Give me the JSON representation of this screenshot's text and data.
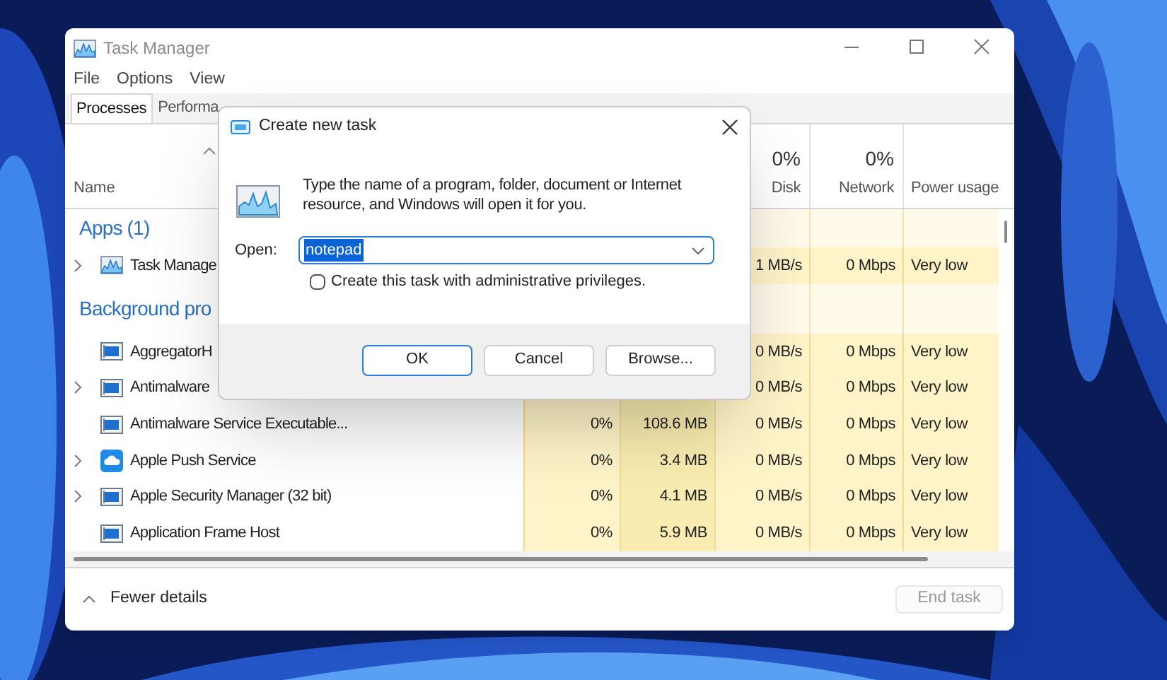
{
  "task_manager": {
    "title": "Task Manager",
    "menu": [
      "File",
      "Options",
      "View"
    ],
    "tabs": [
      {
        "label": "Processes",
        "selected": true
      },
      {
        "label": "Performa",
        "selected": false
      }
    ],
    "header": {
      "name": "Name",
      "disk": {
        "percent": "0%",
        "label": "Disk"
      },
      "network": {
        "percent": "0%",
        "label": "Network"
      },
      "power": {
        "label": "Power usage"
      }
    },
    "groups": [
      {
        "title": "Apps (1)",
        "rows": [
          {
            "name": "Task Manage",
            "expandable": true,
            "kind": "graph",
            "disk": "1 MB/s",
            "network": "0 Mbps",
            "power": "Very low"
          }
        ]
      },
      {
        "title": "Background pro",
        "rows": [
          {
            "name": "AggregatorH",
            "expandable": false,
            "kind": "window",
            "disk": "0 MB/s",
            "network": "0 Mbps",
            "power": "Very low"
          },
          {
            "name": "Antimalware",
            "expandable": true,
            "kind": "window",
            "disk": "0 MB/s",
            "network": "0 Mbps",
            "power": "Very low"
          },
          {
            "name": "Antimalware Service Executable...",
            "expandable": false,
            "kind": "window",
            "cpu": "0%",
            "memory": "108.6 MB",
            "disk": "0 MB/s",
            "network": "0 Mbps",
            "power": "Very low"
          },
          {
            "name": "Apple Push Service",
            "expandable": true,
            "kind": "cloud",
            "cpu": "0%",
            "memory": "3.4 MB",
            "disk": "0 MB/s",
            "network": "0 Mbps",
            "power": "Very low"
          },
          {
            "name": "Apple Security Manager (32 bit)",
            "expandable": true,
            "kind": "window",
            "cpu": "0%",
            "memory": "4.1 MB",
            "disk": "0 MB/s",
            "network": "0 Mbps",
            "power": "Very low"
          },
          {
            "name": "Application Frame Host",
            "expandable": false,
            "kind": "window",
            "cpu": "0%",
            "memory": "5.9 MB",
            "disk": "0 MB/s",
            "network": "0 Mbps",
            "power": "Very low"
          }
        ]
      }
    ],
    "footer": {
      "details": "Fewer details",
      "end_task": {
        "label": "End task",
        "disabled": true
      }
    }
  },
  "dialog": {
    "title": "Create new task",
    "message": "Type the name of a program, folder, document or Internet resource, and Windows will open it for you.",
    "open_label": "Open:",
    "open_value": "notepad",
    "value_selected": true,
    "checkbox": {
      "label": "Create this task with administrative privileges.",
      "checked": false
    },
    "buttons": [
      {
        "label": "OK",
        "default": true
      },
      {
        "label": "Cancel",
        "default": false
      },
      {
        "label": "Browse...",
        "default": false
      }
    ]
  }
}
